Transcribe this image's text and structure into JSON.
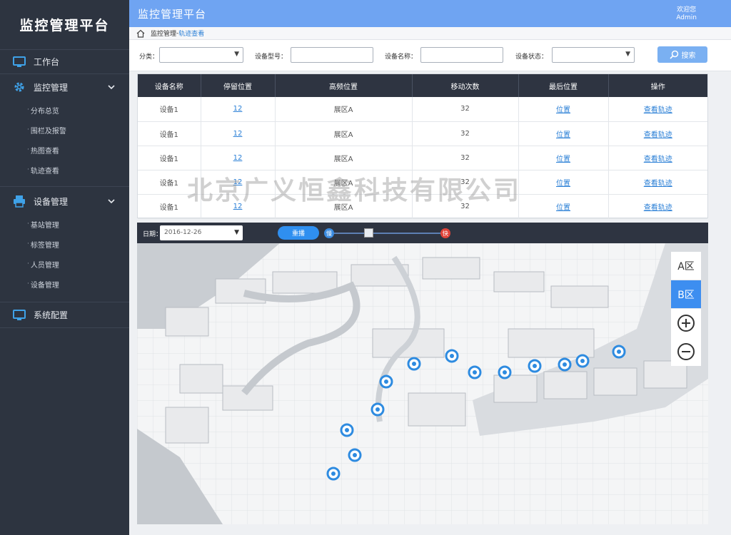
{
  "app": {
    "brand": "监控管理平台",
    "header_title": "监控管理平台",
    "welcome": "欢迎您",
    "user": "Admin"
  },
  "sidebar": {
    "top_item": "工作台",
    "groups": [
      {
        "label": "监控管理",
        "items": [
          "分布总览",
          "围栏及报警",
          "热图查看",
          "轨迹查看"
        ]
      },
      {
        "label": "设备管理",
        "items": [
          "基站管理",
          "标签管理",
          "人员管理",
          "设备管理"
        ]
      }
    ],
    "bottom_item": "系统配置"
  },
  "breadcrumb": {
    "parent": "监控管理",
    "sep": "-",
    "current": "轨迹查看"
  },
  "filters": {
    "category_label": "分类：",
    "model_label": "设备型号：",
    "name_label": "设备名称：",
    "status_label": "设备状态：",
    "search_label": "搜索"
  },
  "table": {
    "headers": [
      "设备名称",
      "停留位置",
      "高频位置",
      "移动次数",
      "最后位置",
      "操作"
    ],
    "rows": [
      [
        "设备1",
        "12",
        "展区A",
        "32",
        "位置",
        "查看轨迹"
      ],
      [
        "设备1",
        "12",
        "展区A",
        "32",
        "位置",
        "查看轨迹"
      ],
      [
        "设备1",
        "12",
        "展区A",
        "32",
        "位置",
        "查看轨迹"
      ],
      [
        "设备1",
        "12",
        "展区A",
        "32",
        "位置",
        "查看轨迹"
      ],
      [
        "设备1",
        "12",
        "展区A",
        "32",
        "位置",
        "查看轨迹"
      ]
    ]
  },
  "watermark": "北京广义恒鑫科技有限公司",
  "map": {
    "date_label": "日期：",
    "date_value": "2016-12-26",
    "replay_label": "重播",
    "slow_label": "慢",
    "fast_label": "快",
    "zones": [
      "A区",
      "B区"
    ],
    "active_zone": "B区"
  },
  "colors": {
    "sidebar": "#2d3440",
    "header": "#6fa4f2",
    "accent": "#2a7fd6",
    "table_head": "#2e3441"
  }
}
